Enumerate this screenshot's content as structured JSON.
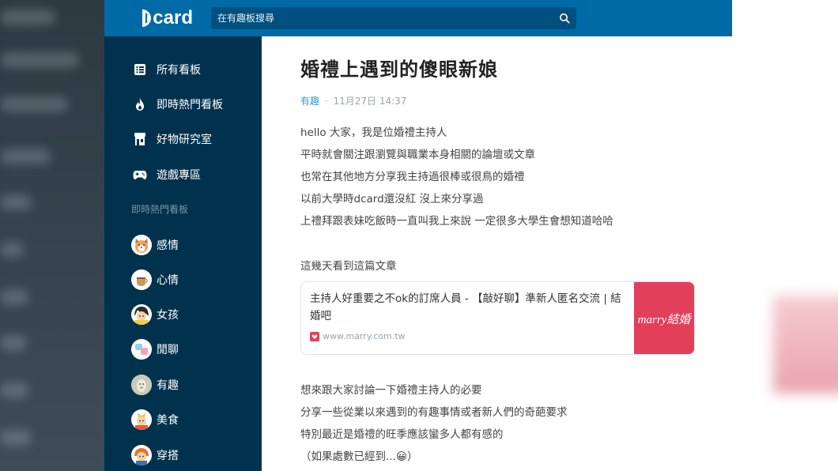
{
  "header": {
    "logo_text": "card",
    "search_placeholder": "在有趣板搜尋"
  },
  "sidebar": {
    "nav_items": [
      {
        "label": "所有看板",
        "icon": "list-icon"
      },
      {
        "label": "即時熱門看板",
        "icon": "flame-icon"
      },
      {
        "label": "好物研究室",
        "icon": "store-icon"
      },
      {
        "label": "遊戲專區",
        "icon": "gamepad-icon"
      }
    ],
    "section_label": "即時熱門看板",
    "forums": [
      {
        "label": "感情"
      },
      {
        "label": "心情"
      },
      {
        "label": "女孩"
      },
      {
        "label": "閒聊"
      },
      {
        "label": "有趣"
      },
      {
        "label": "美食"
      },
      {
        "label": "穿搭"
      }
    ]
  },
  "post": {
    "title": "婚禮上遇到的傻眼新娘",
    "forum": "有趣",
    "separator": "·",
    "date": "11月27日 14:37",
    "paragraph1": [
      "hello 大家，我是位婚禮主持人",
      "平時就會關注跟瀏覽與職業本身相關的論壇或文章",
      "也常在其他地方分享我主持過很棒或很鳥的婚禮",
      "以前大學時dcard還沒紅 沒上來分享過",
      "上禮拜跟表妹吃飯時一直叫我上來說 一定很多大學生會想知道哈哈"
    ],
    "paragraph2": "這幾天看到這篇文章",
    "link_card": {
      "title": "主持人好重要之不ok的訂席人員 - 【敲好聊】準新人匿名交流 | 結婚吧",
      "url": "www.marry.com.tw",
      "thumb_text": "marry結婚"
    },
    "paragraph3": [
      "想來跟大家討論一下婚禮主持人的必要",
      "分享一些從業以來遇到的有趣事情或者新人們的奇葩要求",
      "特別最近是婚禮的旺季應該蠻多人都有感的",
      "（如果處數已經到...😀）"
    ]
  },
  "colors": {
    "header": "#006aa6",
    "sidebar": "#00324e",
    "link": "#3397cf",
    "marry_brand": "#e23f5b"
  }
}
